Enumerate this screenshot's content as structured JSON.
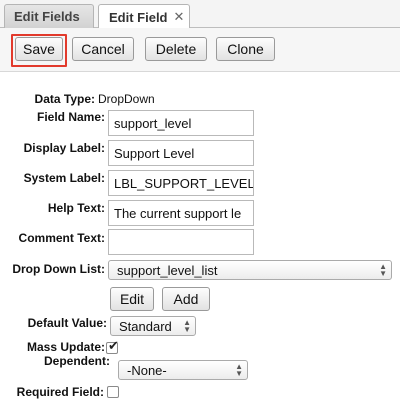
{
  "tabs": [
    {
      "label": "Edit Fields",
      "active": false
    },
    {
      "label": "Edit Field",
      "active": true,
      "close_glyph": "✕"
    }
  ],
  "toolbar": {
    "save_label": "Save",
    "cancel_label": "Cancel",
    "delete_label": "Delete",
    "clone_label": "Clone",
    "highlight_color": "#e23a2c"
  },
  "form": {
    "data_type": {
      "label": "Data Type:",
      "value": "DropDown"
    },
    "field_name": {
      "label": "Field Name:",
      "value": "support_level"
    },
    "display_label": {
      "label": "Display Label:",
      "value": "Support Level"
    },
    "system_label": {
      "label": "System Label:",
      "value": "LBL_SUPPORT_LEVEL"
    },
    "help_text": {
      "label": "Help Text:",
      "value": "The current support le"
    },
    "comment_text": {
      "label": "Comment Text:",
      "value": ""
    },
    "dropdown_list": {
      "label": "Drop Down List:",
      "value": "support_level_list",
      "edit_label": "Edit",
      "add_label": "Add"
    },
    "default_value": {
      "label": "Default Value:",
      "value": "Standard"
    },
    "mass_update": {
      "label": "Mass Update:",
      "checked": true
    },
    "dependent": {
      "label": "Dependent:",
      "value": "-None-"
    },
    "required_field": {
      "label": "Required Field:",
      "checked": false
    }
  },
  "icons": {
    "close": "close-icon",
    "select_arrows": "updown-arrows-icon",
    "checkmark": "checkmark-icon"
  }
}
